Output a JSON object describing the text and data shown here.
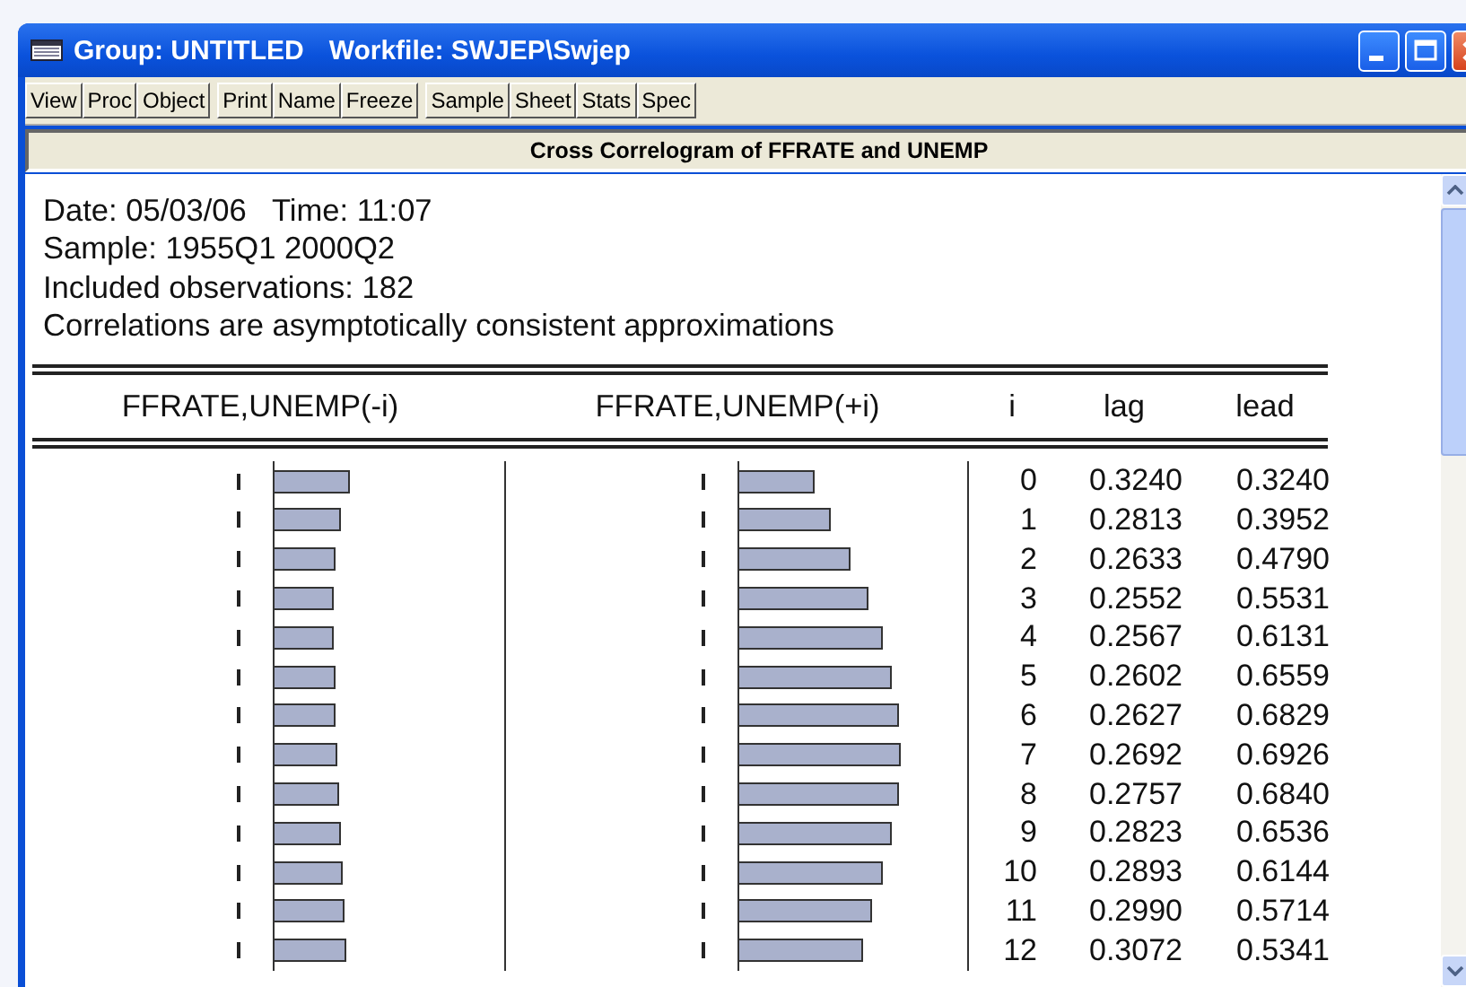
{
  "window": {
    "title": "Group: UNTITLED",
    "workfile": "Workfile: SWJEP\\Swjep"
  },
  "toolbar": [
    [
      "View",
      "Proc",
      "Object"
    ],
    [
      "Print",
      "Name",
      "Freeze"
    ],
    [
      "Sample",
      "Sheet",
      "Stats",
      "Spec"
    ]
  ],
  "view_title": "Cross Correlogram of FFRATE and UNEMP",
  "header_lines": [
    "Date: 05/03/06   Time: 11:07",
    "Sample: 1955Q1 2000Q2",
    "Included observations: 182",
    "Correlations are asymptotically consistent approximations"
  ],
  "table": {
    "columns": [
      "FFRATE,UNEMP(-i)",
      "FFRATE,UNEMP(+i)",
      "i",
      "lag",
      "lead"
    ],
    "rows": [
      {
        "i": "0",
        "lag": "0.3240",
        "lead": "0.3240"
      },
      {
        "i": "1",
        "lag": "0.2813",
        "lead": "0.3952"
      },
      {
        "i": "2",
        "lag": "0.2633",
        "lead": "0.4790"
      },
      {
        "i": "3",
        "lag": "0.2552",
        "lead": "0.5531"
      },
      {
        "i": "4",
        "lag": "0.2567",
        "lead": "0.6131"
      },
      {
        "i": "5",
        "lag": "0.2602",
        "lead": "0.6559"
      },
      {
        "i": "6",
        "lag": "0.2627",
        "lead": "0.6829"
      },
      {
        "i": "7",
        "lag": "0.2692",
        "lead": "0.6926"
      },
      {
        "i": "8",
        "lag": "0.2757",
        "lead": "0.6840"
      },
      {
        "i": "9",
        "lag": "0.2823",
        "lead": "0.6536"
      },
      {
        "i": "10",
        "lag": "0.2893",
        "lead": "0.6144"
      },
      {
        "i": "11",
        "lag": "0.2990",
        "lead": "0.5714"
      },
      {
        "i": "12",
        "lag": "0.3072",
        "lead": "0.5341"
      }
    ]
  }
}
